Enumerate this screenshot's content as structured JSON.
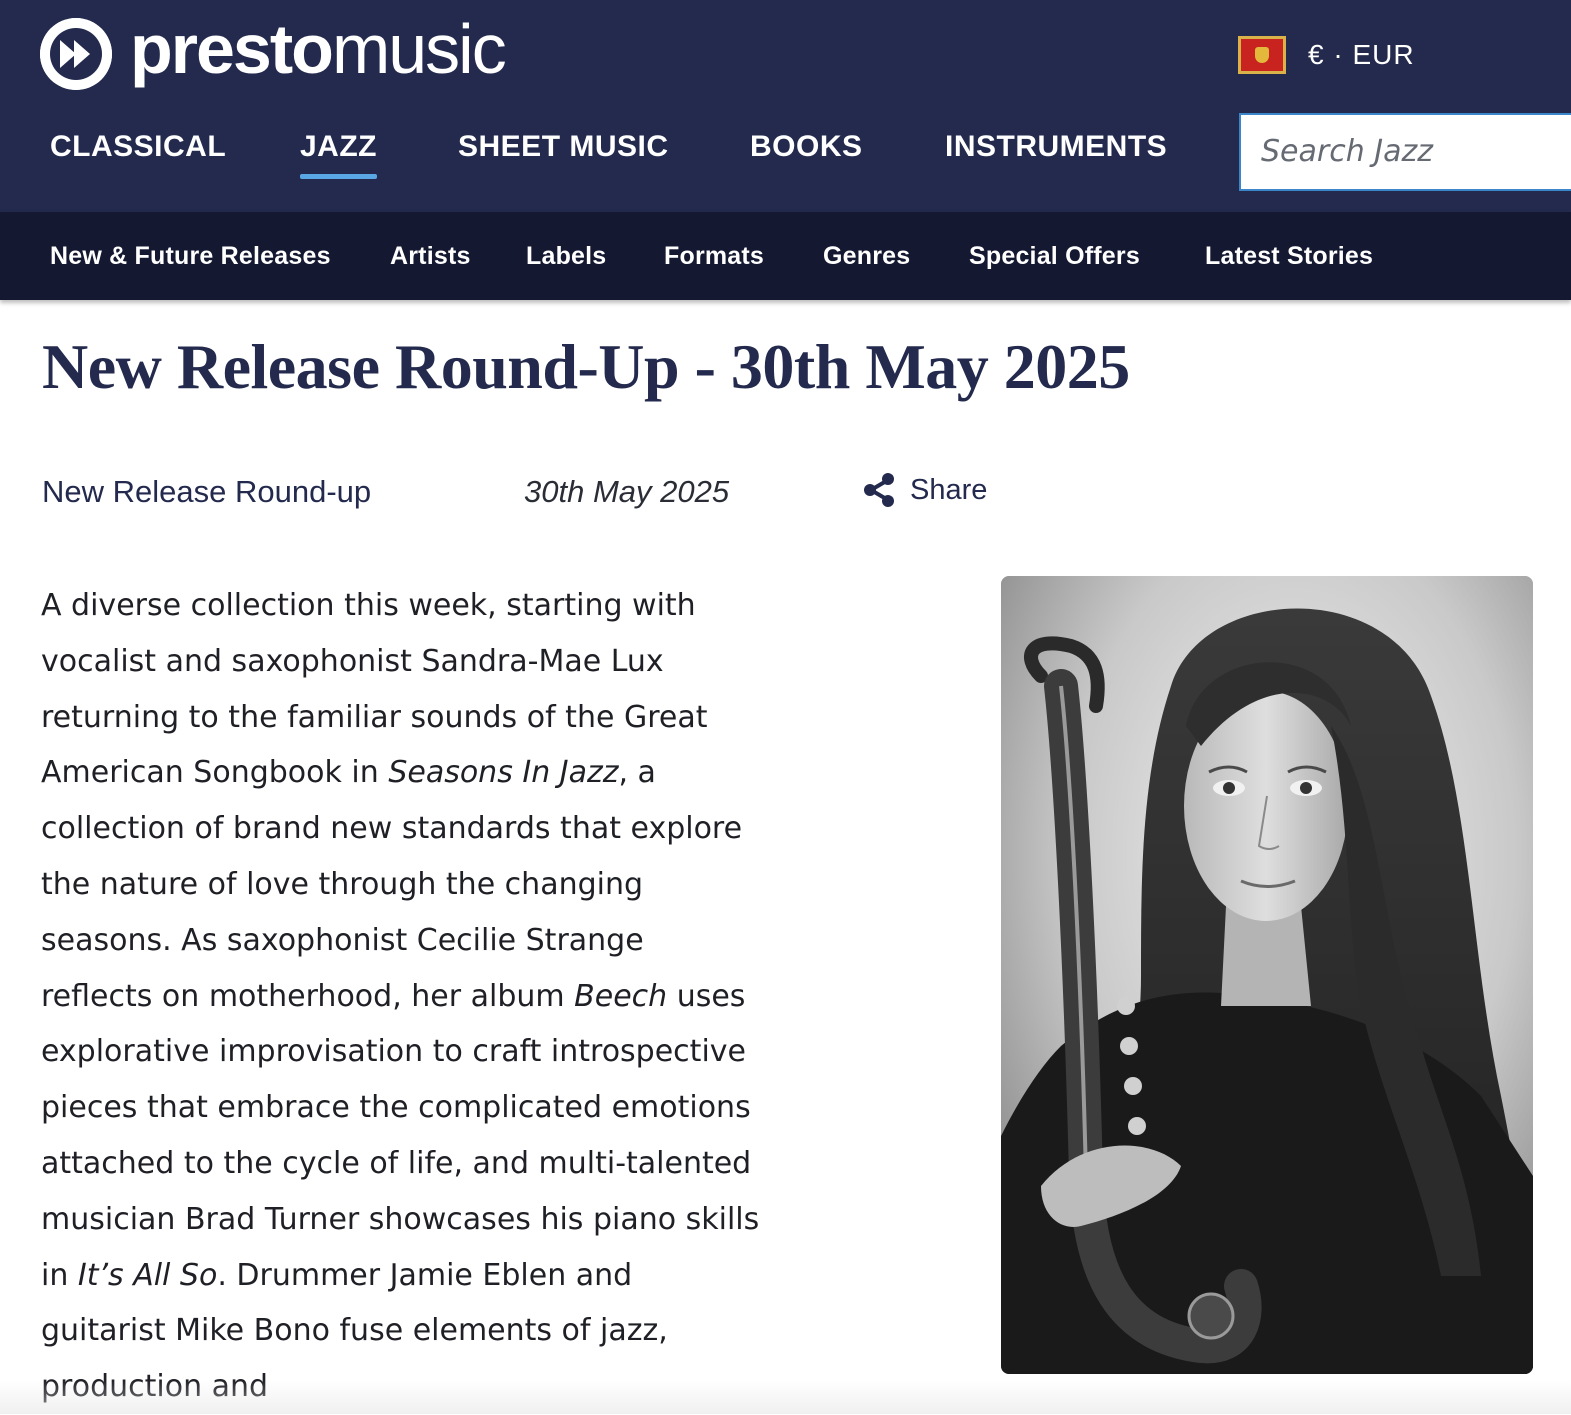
{
  "brand": {
    "name_bold": "presto",
    "name_light": "music",
    "logo_icon": "fast-forward-icon"
  },
  "currency": {
    "flag_icon": "montenegro-flag-icon",
    "label": "€ · EUR"
  },
  "main_nav": [
    {
      "label": "CLASSICAL",
      "active": false
    },
    {
      "label": "JAZZ",
      "active": true
    },
    {
      "label": "SHEET MUSIC",
      "active": false
    },
    {
      "label": "BOOKS",
      "active": false
    },
    {
      "label": "INSTRUMENTS",
      "active": false
    }
  ],
  "search": {
    "placeholder": "Search Jazz",
    "value": ""
  },
  "sub_nav": [
    {
      "label": "New & Future Releases"
    },
    {
      "label": "Artists"
    },
    {
      "label": "Labels"
    },
    {
      "label": "Formats"
    },
    {
      "label": "Genres"
    },
    {
      "label": "Special Offers"
    },
    {
      "label": "Latest Stories"
    }
  ],
  "article": {
    "title": "New Release Round-Up - 30th May 2025",
    "category": "New Release Round-up",
    "date": "30th May 2025",
    "share_label": "Share",
    "share_icon": "share-icon",
    "body": [
      {
        "text": "A diverse collection this week, starting with vocalist and saxophonist Sandra-Mae Lux returning to the familiar sounds of the Great American Songbook in "
      },
      {
        "text": "Seasons In Jazz",
        "italic": true
      },
      {
        "text": ", a collection of brand new standards that explore the nature of love through the changing seasons. As saxophonist Cecilie Strange reflects on motherhood, her album "
      },
      {
        "text": "Beech",
        "italic": true
      },
      {
        "text": " uses explorative improvisation to craft introspective pieces that embrace the complicated emotions attached to the cycle of life, and multi-talented musician Brad Turner showcases his piano skills in "
      },
      {
        "text": "It’s All So",
        "italic": true
      },
      {
        "text": ". Drummer Jamie Eblen and guitarist Mike Bono fuse elements of jazz, production and"
      }
    ],
    "image": {
      "description_icon": "saxophonist-portrait-photo"
    }
  },
  "colors": {
    "header_bg": "#232a4d",
    "subnav_bg": "#141831",
    "accent": "#5aa7e6",
    "title": "#232a4d"
  }
}
